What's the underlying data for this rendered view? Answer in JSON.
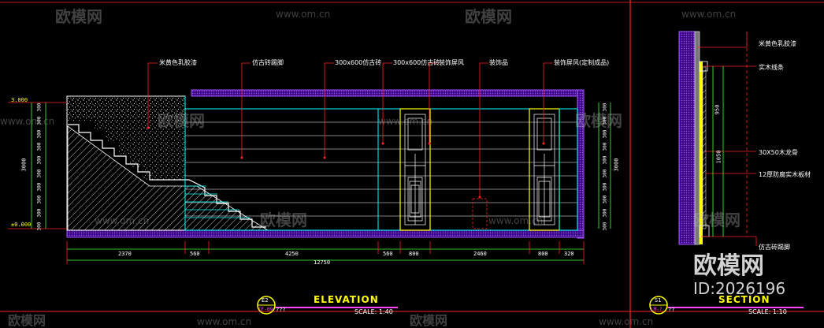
{
  "watermark": {
    "brand": "欧模网",
    "url": "www.om.cn",
    "id_label": "ID:2026196"
  },
  "elevation": {
    "title": "ELEVATION",
    "scale": "SCALE: 1:40",
    "tag_top": "E2",
    "tag_bottom": "IF-09",
    "tag_extra": "???",
    "callouts": [
      "米黄色乳胶漆",
      "仿古砖踢脚",
      "300x600仿古砖",
      "300x600仿古砖",
      "装饰屏风",
      "装饰品",
      "装饰屏风(定制成品)"
    ],
    "left_levels": [
      "3.000",
      "±0.000"
    ],
    "left_dims": [
      "300",
      "300",
      "300",
      "300",
      "300",
      "300",
      "300",
      "300",
      "300",
      "300"
    ],
    "left_total": "3000",
    "right_dims": [
      "300",
      "300",
      "300",
      "300",
      "300",
      "300",
      "300",
      "300",
      "300",
      "300"
    ],
    "right_total": "3000",
    "bottom_dims": [
      "2370",
      "560",
      "4250",
      "560",
      "800",
      "2460",
      "800",
      "320"
    ],
    "bottom_total": "12750"
  },
  "section": {
    "title": "SECTION",
    "scale": "SCALE: 1:10",
    "tag_top": "S1",
    "tag_bottom": "LM-?",
    "tag_extra": "??",
    "callouts": [
      "米黄色乳胶漆",
      "实木线条",
      "30X50木龙骨",
      "12厚防腐实木板材",
      "仿古砖踢脚"
    ],
    "dims": [
      "950",
      "1050"
    ]
  },
  "colors": {
    "red": "#ff2020",
    "cyan": "#00ffff",
    "yellow": "#ffff00",
    "purple": "#8020ff",
    "white": "#ffffff",
    "green": "#40ff40",
    "magenta": "#ff40ff"
  }
}
